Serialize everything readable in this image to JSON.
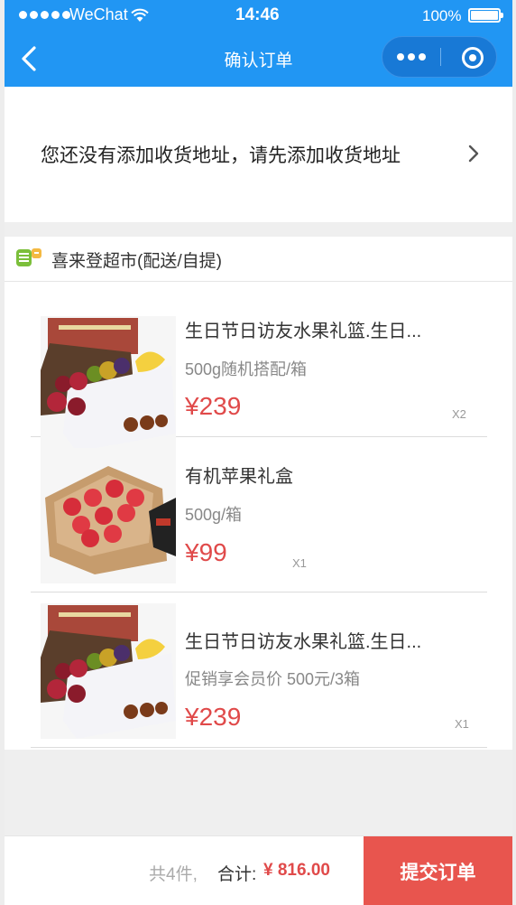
{
  "status_bar": {
    "carrier": "WeChat",
    "time": "14:46",
    "battery": "100%"
  },
  "nav": {
    "title": "确认订单"
  },
  "address": {
    "prompt": "您还没有添加收货地址，请先添加收货地址"
  },
  "store": {
    "name": "喜来登超市(配送/自提)"
  },
  "items": [
    {
      "title": "生日节日访友水果礼篮.生日...",
      "spec": "500g随机搭配/箱",
      "price": "¥239",
      "qty": "X2"
    },
    {
      "title": "有机苹果礼盒",
      "spec": "500g/箱",
      "price": "¥99",
      "qty": "X1"
    },
    {
      "title": "生日节日访友水果礼篮.生日...",
      "spec": "促销享会员价 500元/3箱",
      "price": "¥239",
      "qty": "X1"
    }
  ],
  "footer": {
    "count": "共4件,",
    "total_label": "合计:",
    "total_value": "¥ 816.00",
    "submit_label": "提交订单"
  },
  "colors": {
    "nav_bg": "#2196f3",
    "accent_red": "#e8554e",
    "price_red": "#e04a4a"
  }
}
